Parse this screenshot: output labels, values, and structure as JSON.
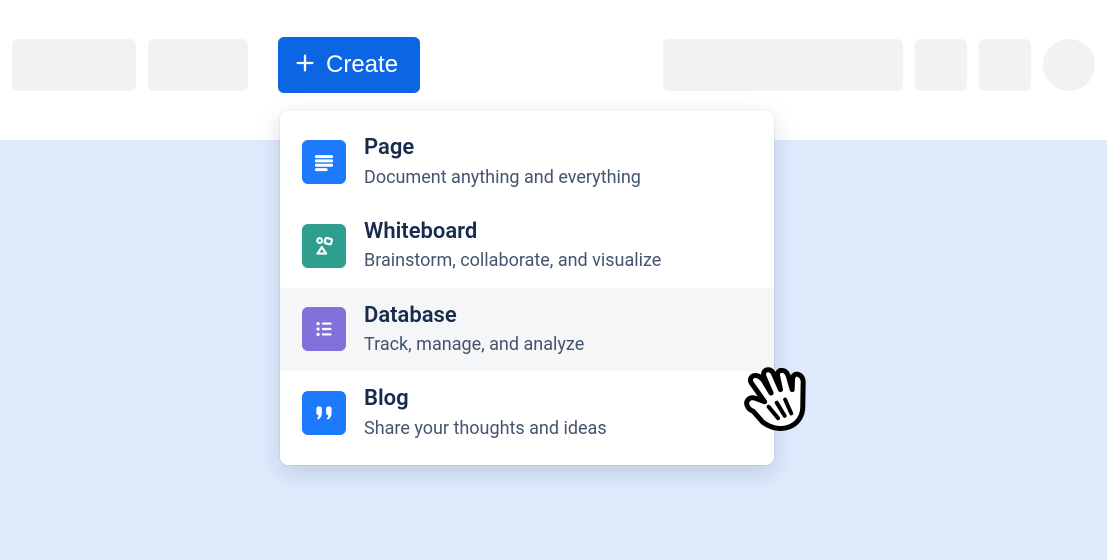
{
  "toolbar": {
    "create_label": "Create"
  },
  "menu": {
    "items": [
      {
        "title": "Page",
        "desc": "Document anything and everything",
        "icon": "page-icon",
        "icon_bg": "#1d7afc"
      },
      {
        "title": "Whiteboard",
        "desc": "Brainstorm, collaborate, and visualize",
        "icon": "whiteboard-icon",
        "icon_bg": "#2e9e8f"
      },
      {
        "title": "Database",
        "desc": "Track, manage, and analyze",
        "icon": "database-icon",
        "icon_bg": "#8270db"
      },
      {
        "title": "Blog",
        "desc": "Share your thoughts and ideas",
        "icon": "blog-icon",
        "icon_bg": "#1d7afc"
      }
    ]
  }
}
